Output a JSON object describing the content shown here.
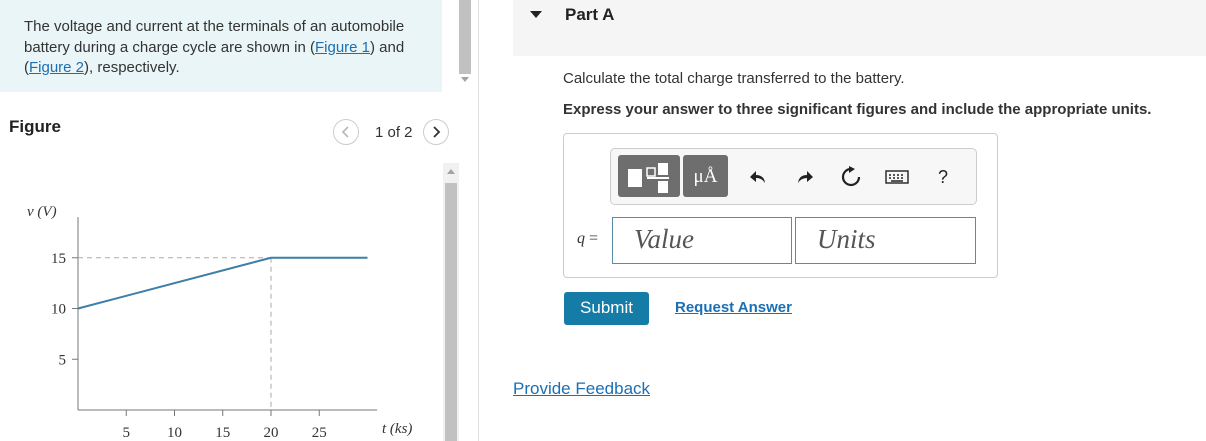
{
  "intro": {
    "text_before": "The voltage and current at the terminals of an automobile battery during a charge cycle are shown in (",
    "link1": "Figure 1",
    "text_mid": ") and (",
    "link2": "Figure 2",
    "text_after": "), respectively."
  },
  "figure": {
    "title": "Figure",
    "counter": "1 of 2",
    "prev_icon": "chevron-left-icon",
    "next_icon": "chevron-right-icon"
  },
  "chart_data": {
    "type": "line",
    "ylabel": "v (V)",
    "xlabel": "t (ks)",
    "x_ticks": [
      "5",
      "10",
      "15",
      "20",
      "25"
    ],
    "y_ticks": [
      "5",
      "10",
      "15"
    ],
    "x": [
      0,
      20,
      30
    ],
    "y": [
      10,
      15,
      15
    ],
    "xlim": [
      0,
      31
    ],
    "ylim": [
      0,
      19
    ],
    "reference_lines": [
      {
        "y": 15,
        "x": 20
      }
    ],
    "colors": {
      "line": "#3d7fa6",
      "axes": "#777777",
      "dashed": "#aaaaaa"
    }
  },
  "part": {
    "title": "Part A",
    "question": "Calculate the total charge transferred to the battery.",
    "instruction": "Express your answer to three significant figures and include the appropriate units."
  },
  "toolbar": {
    "units_label": "μÅ",
    "icons": [
      "templates-icon",
      "units-icon",
      "undo-icon",
      "redo-icon",
      "reset-icon",
      "keyboard-icon",
      "help-icon"
    ],
    "help_label": "?"
  },
  "answer": {
    "variable": "q",
    "equals": "=",
    "value_placeholder": "Value",
    "units_placeholder": "Units"
  },
  "buttons": {
    "submit": "Submit",
    "request": "Request Answer",
    "feedback": "Provide Feedback"
  },
  "colors": {
    "accent": "#157ca8",
    "link": "#1a6fb5",
    "intro_bg": "#e9f5f6"
  }
}
